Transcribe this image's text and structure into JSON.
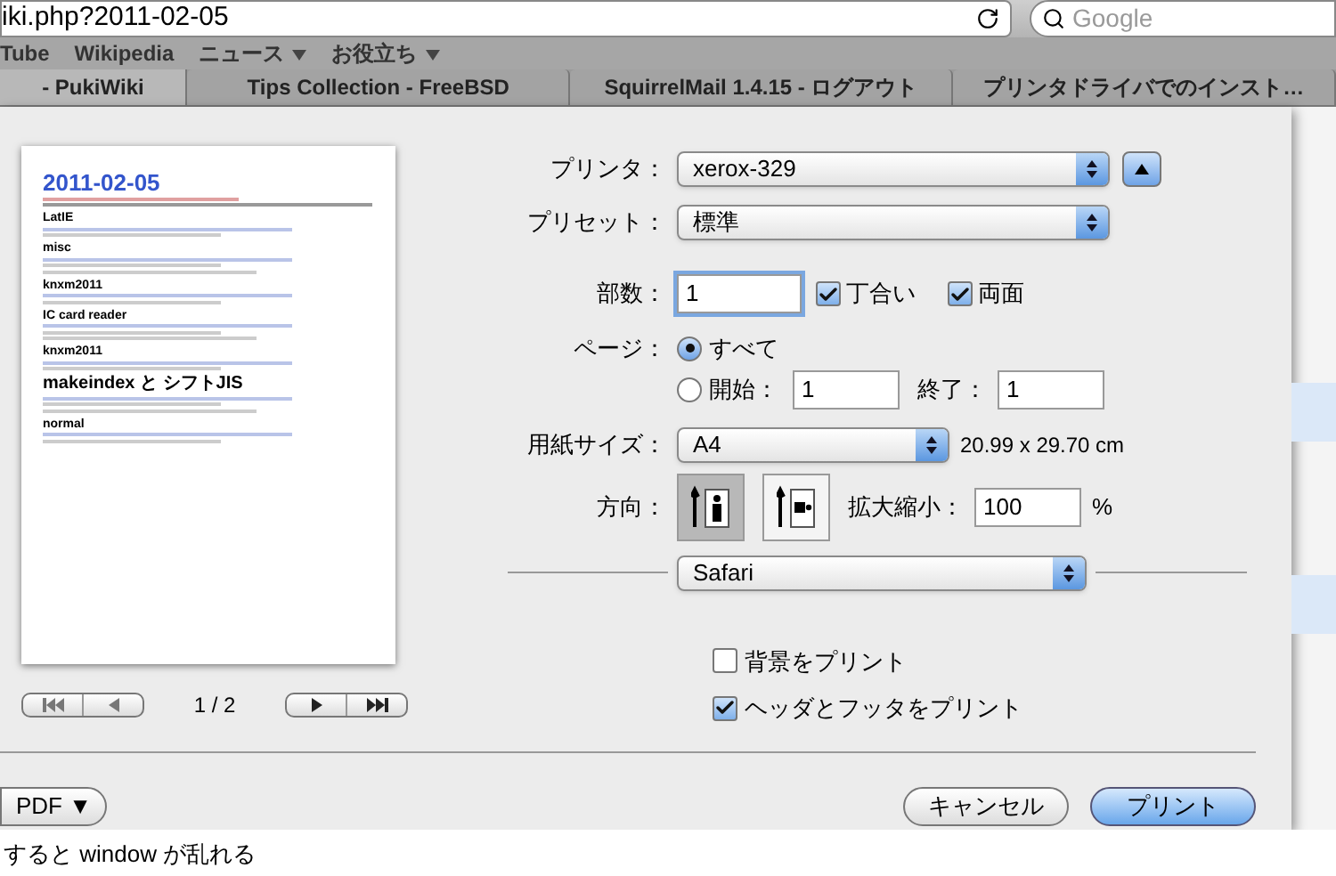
{
  "address_bar": {
    "url": "iki.php?2011-02-05",
    "search_placeholder": "Google"
  },
  "bookmarks": [
    {
      "label": "Tube",
      "menu": false
    },
    {
      "label": "Wikipedia",
      "menu": false
    },
    {
      "label": "ニュース",
      "menu": true
    },
    {
      "label": "お役立ち",
      "menu": true
    }
  ],
  "tabs": [
    {
      "label": "- PukiWiki",
      "selected": true
    },
    {
      "label": "Tips Collection - FreeBSD",
      "selected": false
    },
    {
      "label": "SquirrelMail 1.4.15 - ログアウト",
      "selected": false
    },
    {
      "label": "プリンタドライバでのインスト…",
      "selected": false
    }
  ],
  "preview": {
    "title": "2011-02-05",
    "sections": [
      "LatIE",
      "misc",
      "knxm2011",
      "IC card reader",
      "knxm2011",
      "makeindex と シフトJIS",
      "normal"
    ],
    "page_indicator": "1 / 2"
  },
  "print_form": {
    "printer_label": "プリンタ：",
    "printer": "xerox-329",
    "preset_label": "プリセット：",
    "preset": "標準",
    "copies_label": "部数：",
    "copies": "1",
    "collate": {
      "label": "丁合い",
      "checked": true
    },
    "duplex": {
      "label": "両面",
      "checked": true
    },
    "pages_label": "ページ：",
    "page_options": [
      {
        "label": "すべて",
        "selected": true
      },
      {
        "label": "開始：",
        "selected": false
      }
    ],
    "from": "1",
    "to_label": "終了：",
    "to": "1",
    "paper_label": "用紙サイズ：",
    "paper": "A4",
    "paper_dims": "20.99 x 29.70 cm",
    "orientation_label": "方向：",
    "orientations": [
      {
        "kind": "portrait",
        "selected": true
      },
      {
        "kind": "landscape",
        "selected": false
      }
    ],
    "scale_label": "拡大縮小：",
    "scale": "100",
    "scale_unit": "%",
    "section": "Safari",
    "options": [
      {
        "label": "背景をプリント",
        "checked": false
      },
      {
        "label": "ヘッダとフッタをプリント",
        "checked": true
      }
    ]
  },
  "buttons": {
    "pdf": "PDF ▼",
    "cancel": "キャンセル",
    "print": "プリント"
  },
  "page_behind": {
    "text": "すると window が乱れる"
  }
}
